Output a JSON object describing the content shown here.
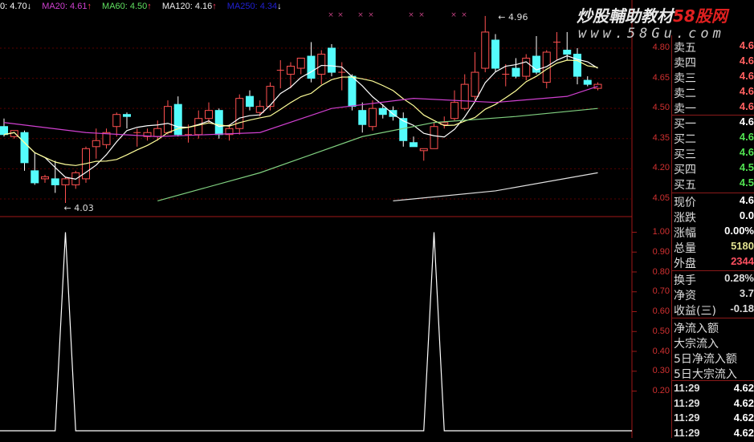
{
  "header": {
    "ma10": "0: 4.70",
    "ma10_arrow": "↓",
    "ma20": "MA20: 4.61",
    "ma20_arrow": "↑",
    "ma60": "MA60: 4.50",
    "ma60_arrow": "↑",
    "ma120": "MA120: 4.16",
    "ma120_arrow": "↑",
    "ma250": "MA250: 4.34",
    "ma250_arrow": "↓"
  },
  "watermark": {
    "line1a": "炒股輔助教材",
    "line1b": "58股网",
    "line2": "www.58Gu.com"
  },
  "colors": {
    "up": "#ff5050",
    "down": "#54fcfc",
    "ma5": "#ffffff",
    "ma10": "#ffff99",
    "ma20": "#d040d0",
    "ma60": "#80d080",
    "ma120": "#e0e0e0",
    "grid": "#5a0000",
    "axis": "#a01818"
  },
  "price_axis": [
    "4.80",
    "4.65",
    "4.50",
    "4.35",
    "4.20",
    "4.05"
  ],
  "indicator_axis": [
    "1.00",
    "0.90",
    "0.80",
    "0.70",
    "0.60",
    "0.50",
    "0.40",
    "0.30",
    "0.20"
  ],
  "annotations": {
    "high": "4.96",
    "low": "4.03"
  },
  "chart_data": {
    "type": "candlestick",
    "price_range": [
      4.0,
      5.0
    ],
    "candles": [
      [
        4.41,
        4.45,
        4.36,
        4.37
      ],
      [
        4.36,
        4.39,
        4.35,
        4.39
      ],
      [
        4.38,
        4.39,
        4.19,
        4.23
      ],
      [
        4.19,
        4.28,
        4.12,
        4.13
      ],
      [
        4.15,
        4.17,
        4.13,
        4.16
      ],
      [
        4.15,
        4.24,
        4.08,
        4.12
      ],
      [
        4.12,
        4.16,
        4.03,
        4.15
      ],
      [
        4.12,
        4.19,
        4.1,
        4.18
      ],
      [
        4.15,
        4.31,
        4.13,
        4.3
      ],
      [
        4.31,
        4.4,
        4.25,
        4.34
      ],
      [
        4.32,
        4.4,
        4.3,
        4.38
      ],
      [
        4.41,
        4.48,
        4.36,
        4.47
      ],
      [
        4.47,
        4.48,
        4.4,
        4.46
      ],
      [
        4.38,
        4.4,
        4.31,
        4.38
      ],
      [
        4.36,
        4.4,
        4.34,
        4.38
      ],
      [
        4.36,
        4.44,
        4.34,
        4.4
      ],
      [
        4.38,
        4.54,
        4.37,
        4.51
      ],
      [
        4.52,
        4.56,
        4.36,
        4.37
      ],
      [
        4.37,
        4.42,
        4.33,
        4.37
      ],
      [
        4.37,
        4.49,
        4.35,
        4.45
      ],
      [
        4.45,
        4.53,
        4.43,
        4.49
      ],
      [
        4.49,
        4.5,
        4.35,
        4.37
      ],
      [
        4.37,
        4.42,
        4.34,
        4.4
      ],
      [
        4.4,
        4.57,
        4.37,
        4.55
      ],
      [
        4.56,
        4.59,
        4.49,
        4.51
      ],
      [
        4.48,
        4.54,
        4.46,
        4.51
      ],
      [
        4.51,
        4.63,
        4.49,
        4.61
      ],
      [
        4.69,
        4.74,
        4.6,
        4.69
      ],
      [
        4.67,
        4.73,
        4.6,
        4.71
      ],
      [
        4.7,
        4.75,
        4.67,
        4.75
      ],
      [
        4.76,
        4.83,
        4.63,
        4.65
      ],
      [
        4.67,
        4.79,
        4.62,
        4.77
      ],
      [
        4.8,
        4.82,
        4.66,
        4.68
      ],
      [
        4.68,
        4.73,
        4.59,
        4.68
      ],
      [
        4.66,
        4.67,
        4.49,
        4.51
      ],
      [
        4.49,
        4.53,
        4.38,
        4.42
      ],
      [
        4.41,
        4.54,
        4.39,
        4.5
      ],
      [
        4.5,
        4.52,
        4.45,
        4.47
      ],
      [
        4.49,
        4.51,
        4.44,
        4.46
      ],
      [
        4.45,
        4.48,
        4.31,
        4.34
      ],
      [
        4.33,
        4.36,
        4.31,
        4.31
      ],
      [
        4.29,
        4.3,
        4.24,
        4.3
      ],
      [
        4.3,
        4.43,
        4.3,
        4.41
      ],
      [
        4.42,
        4.46,
        4.4,
        4.43
      ],
      [
        4.45,
        4.59,
        4.44,
        4.53
      ],
      [
        4.5,
        4.67,
        4.49,
        4.62
      ],
      [
        4.56,
        4.78,
        4.54,
        4.68
      ],
      [
        4.7,
        4.96,
        4.68,
        4.88
      ],
      [
        4.84,
        4.87,
        4.68,
        4.7
      ],
      [
        4.67,
        4.72,
        4.61,
        4.67
      ],
      [
        4.7,
        4.75,
        4.65,
        4.66
      ],
      [
        4.66,
        4.77,
        4.64,
        4.75
      ],
      [
        4.76,
        4.86,
        4.67,
        4.68
      ],
      [
        4.63,
        4.79,
        4.6,
        4.78
      ],
      [
        4.83,
        4.88,
        4.74,
        4.83
      ],
      [
        4.79,
        4.88,
        4.74,
        4.77
      ],
      [
        4.77,
        4.8,
        4.62,
        4.66
      ],
      [
        4.64,
        4.66,
        4.61,
        4.62
      ],
      [
        4.6,
        4.63,
        4.59,
        4.62
      ]
    ],
    "ma20": [
      [
        0,
        4.43
      ],
      [
        8,
        4.38
      ],
      [
        15,
        4.36
      ],
      [
        25,
        4.38
      ],
      [
        32,
        4.5
      ],
      [
        40,
        4.55
      ],
      [
        48,
        4.53
      ],
      [
        55,
        4.56
      ],
      [
        58,
        4.61
      ]
    ],
    "ma60": [
      [
        15,
        4.04
      ],
      [
        25,
        4.18
      ],
      [
        35,
        4.36
      ],
      [
        42,
        4.43
      ],
      [
        50,
        4.46
      ],
      [
        58,
        4.5
      ]
    ],
    "ma120": [
      [
        38,
        4.04
      ],
      [
        48,
        4.09
      ],
      [
        58,
        4.18
      ]
    ],
    "signal": {
      "range": [
        0,
        1
      ],
      "values_nonzero": {
        "6": 1,
        "42": 1
      },
      "start_index": 5
    }
  },
  "panel": {
    "ask": [
      {
        "label": "卖五",
        "value": "4.6"
      },
      {
        "label": "卖四",
        "value": "4.6"
      },
      {
        "label": "卖三",
        "value": "4.6"
      },
      {
        "label": "卖二",
        "value": "4.6"
      },
      {
        "label": "卖一",
        "value": "4.6"
      }
    ],
    "bid": [
      {
        "label": "买一",
        "value": "4.6"
      },
      {
        "label": "买二",
        "value": "4.6"
      },
      {
        "label": "买三",
        "value": "4.6"
      },
      {
        "label": "买四",
        "value": "4.5"
      },
      {
        "label": "买五",
        "value": "4.5"
      }
    ],
    "quote": [
      {
        "label": "现价",
        "value": "4.6"
      },
      {
        "label": "涨跌",
        "value": "0.0"
      },
      {
        "label": "涨幅",
        "value": "0.00%"
      },
      {
        "label": "总量",
        "value": "5180"
      },
      {
        "label": "外盘",
        "value": "2344"
      }
    ],
    "fund": [
      {
        "label": "换手",
        "value": "0.28%"
      },
      {
        "label": "净资",
        "value": "3.7"
      },
      {
        "label": "收益(三)",
        "value": "-0.18"
      }
    ],
    "flow": [
      {
        "label": "净流入额"
      },
      {
        "label": "大宗流入"
      },
      {
        "label": "5日净流入额"
      },
      {
        "label": "5日大宗流入"
      }
    ],
    "ticks": [
      {
        "time": "11:29",
        "price": "4.62"
      },
      {
        "time": "11:29",
        "price": "4.62"
      },
      {
        "time": "11:29",
        "price": "4.62"
      },
      {
        "time": "11:29",
        "price": "4.62"
      }
    ]
  }
}
